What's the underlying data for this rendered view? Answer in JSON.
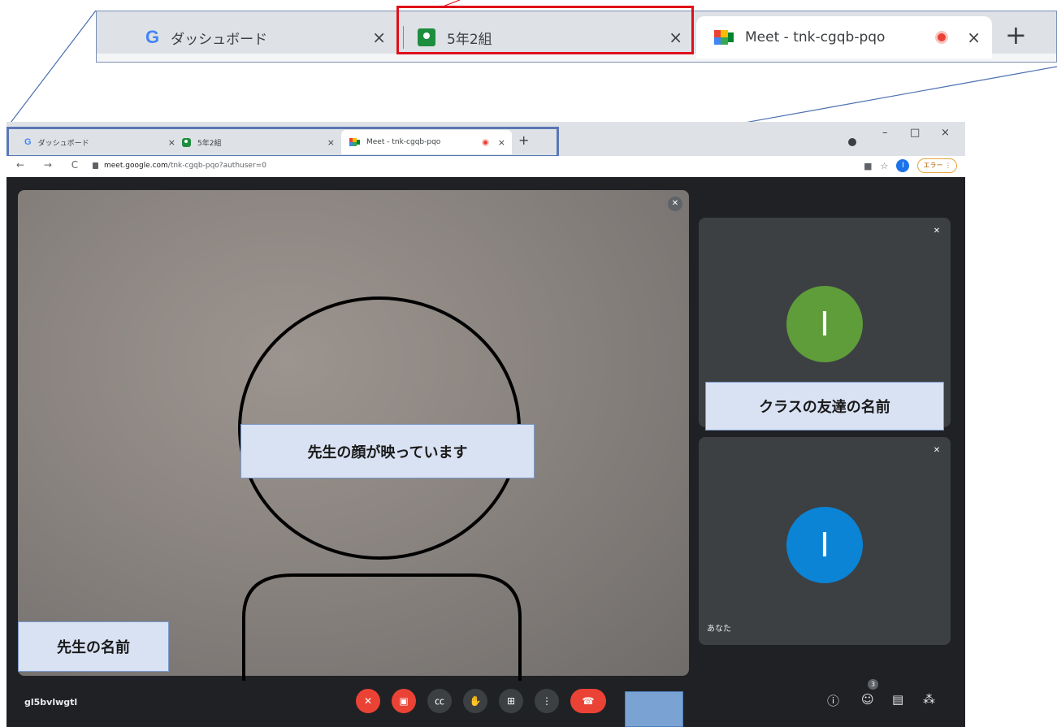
{
  "zoom_tabs": [
    {
      "label": "ダッシュボード",
      "icon": "google-g-icon"
    },
    {
      "label": "5年2組",
      "icon": "classroom-icon"
    },
    {
      "label": "Meet - tnk-cgqb-pqo",
      "icon": "meet-icon"
    }
  ],
  "tab_close": "×",
  "new_tab": "+",
  "google_g": "G",
  "browser": {
    "tabs": [
      {
        "label": "ダッシュボード"
      },
      {
        "label": "5年2組"
      },
      {
        "label": "Meet - tnk-cgqb-pqo"
      }
    ],
    "window_controls": {
      "minimize": "–",
      "maximize": "□",
      "close": "×"
    },
    "nav": "← → C",
    "url_host": "meet.google.com",
    "url_path": "/tnk-cgqb-pqo?authuser=0",
    "profile_initial": "I",
    "error_label": "エラー ⋮",
    "toolbar_icons": [
      "camera-icon",
      "star-icon"
    ]
  },
  "meet": {
    "participants": [
      {
        "initial": "I",
        "color": "#5f9d3a",
        "name": ""
      },
      {
        "initial": "I",
        "color": "#0b84d6",
        "name": "あなた"
      }
    ],
    "meeting_code": "gl5bvlwgtl",
    "people_count": "3",
    "controls": [
      "mic-off-icon",
      "camera-off-icon",
      "captions-icon",
      "raise-hand-icon",
      "present-icon",
      "more-icon",
      "hangup-icon"
    ],
    "right_controls": [
      "info-icon",
      "people-icon",
      "chat-icon",
      "activities-icon"
    ]
  },
  "annotations": {
    "teacher_face": "先生の顔が映っています",
    "teacher_name": "先生の名前",
    "friend_name": "クラスの友達の名前"
  },
  "colors": {
    "highlight_red": "#e0101a",
    "highlight_blue": "#5a77b5",
    "hangup": "#ea4335"
  }
}
